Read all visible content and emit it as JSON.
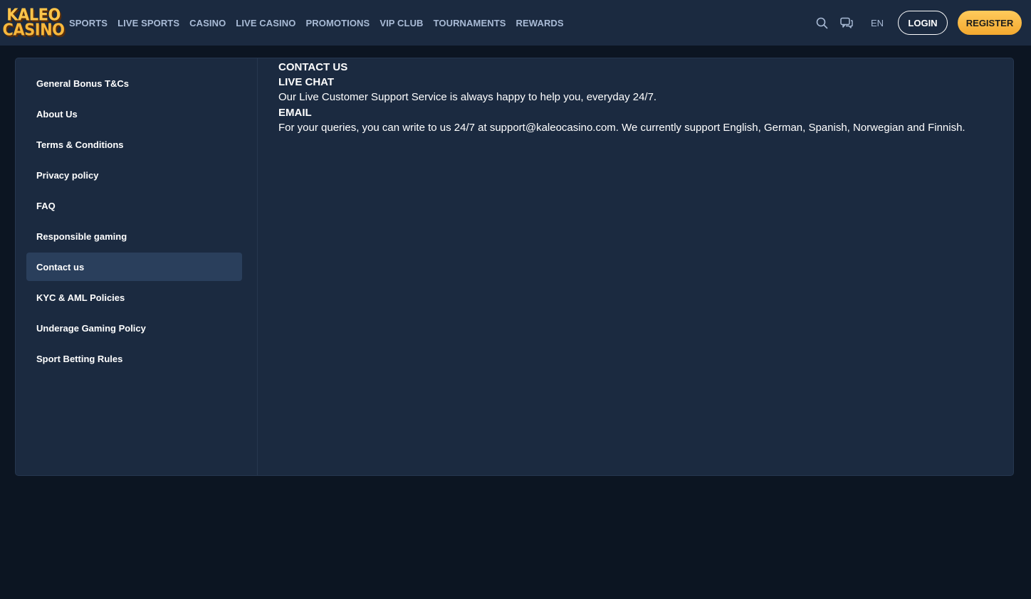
{
  "header": {
    "logo": {
      "line1": "KALEO",
      "line2": "CASINO"
    },
    "nav": [
      {
        "id": "sports",
        "label": "SPORTS"
      },
      {
        "id": "live-sports",
        "label": "LIVE SPORTS"
      },
      {
        "id": "casino",
        "label": "CASINO"
      },
      {
        "id": "live-casino",
        "label": "LIVE CASINO"
      },
      {
        "id": "promotions",
        "label": "PROMOTIONS"
      },
      {
        "id": "vip-club",
        "label": "VIP CLUB"
      },
      {
        "id": "tournaments",
        "label": "TOURNAMENTS"
      },
      {
        "id": "rewards",
        "label": "REWARDS"
      }
    ],
    "icons": {
      "search": "search-icon",
      "chat": "chat-icon"
    },
    "language": "EN",
    "login_label": "LOGIN",
    "register_label": "REGISTER"
  },
  "sidebar": {
    "items": [
      {
        "label": "General Bonus T&Cs",
        "active": false
      },
      {
        "label": "About Us",
        "active": false
      },
      {
        "label": "Terms & Conditions",
        "active": false
      },
      {
        "label": "Privacy policy",
        "active": false
      },
      {
        "label": "FAQ",
        "active": false
      },
      {
        "label": "Responsible gaming",
        "active": false
      },
      {
        "label": "Contact us",
        "active": true
      },
      {
        "label": "KYC & AML Policies",
        "active": false
      },
      {
        "label": "Underage Gaming Policy",
        "active": false
      },
      {
        "label": "Sport Betting Rules",
        "active": false
      }
    ]
  },
  "content": {
    "title": "CONTACT US",
    "live_chat_heading": "LIVE CHAT",
    "live_chat_text": "Our Live Customer Support Service is always happy to help you, everyday 24/7.",
    "email_heading": "EMAIL",
    "email_text": "For your queries, you can write to us 24/7 at support@kaleocasino.com. We currently support English, German, Spanish, Norwegian and Finnish."
  },
  "colors": {
    "header_bg": "#1b2a40",
    "page_bg": "#0c1522",
    "accent": "#f8b83c",
    "nav_text": "#a9bbd6",
    "active_item_bg": "#2a3f5c"
  }
}
